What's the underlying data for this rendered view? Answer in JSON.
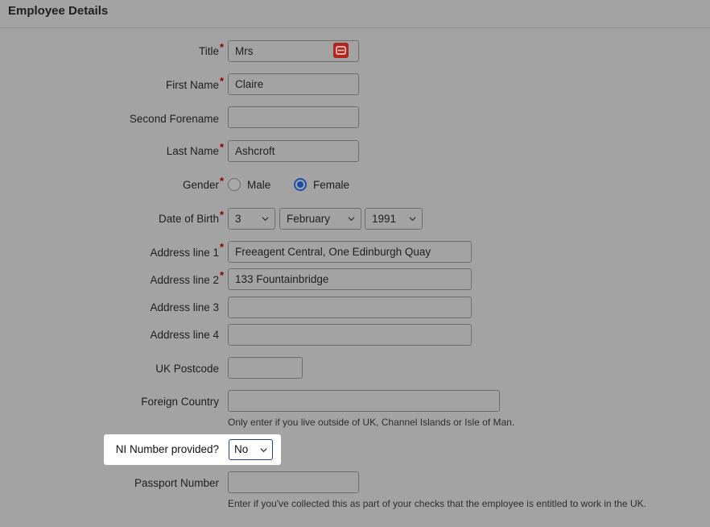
{
  "section": {
    "title": "Employee Details"
  },
  "fields": {
    "title": {
      "label": "Title",
      "value": "Mrs"
    },
    "first_name": {
      "label": "First Name",
      "value": "Claire"
    },
    "second_forename": {
      "label": "Second Forename",
      "value": ""
    },
    "last_name": {
      "label": "Last Name",
      "value": "Ashcroft"
    },
    "gender": {
      "label": "Gender",
      "options": [
        "Male",
        "Female"
      ],
      "selected": "Female"
    },
    "dob": {
      "label": "Date of Birth",
      "day": "3",
      "month": "February",
      "year": "1991"
    },
    "address1": {
      "label": "Address line 1",
      "value": "Freeagent Central, One Edinburgh Quay"
    },
    "address2": {
      "label": "Address line 2",
      "value": "133 Fountainbridge"
    },
    "address3": {
      "label": "Address line 3",
      "value": ""
    },
    "address4": {
      "label": "Address line 4",
      "value": ""
    },
    "postcode": {
      "label": "UK Postcode",
      "value": ""
    },
    "foreign_country": {
      "label": "Foreign Country",
      "value": "",
      "hint": "Only enter if you live outside of UK, Channel Islands or Isle of Man."
    },
    "ni_provided": {
      "label": "NI Number provided?",
      "value": "No"
    },
    "passport": {
      "label": "Passport Number",
      "value": "",
      "hint": "Enter if you've collected this as part of your checks that the employee is entitled to work in the UK."
    }
  },
  "required_marker": "*",
  "colors": {
    "background": "#a3a3a3",
    "required": "#8b0000",
    "radio_selected": "#1a4fa8",
    "password_manager_icon": "#b3261e"
  },
  "icons": {
    "password_manager": "password-manager-icon",
    "chevron": "chevron-down-icon"
  }
}
